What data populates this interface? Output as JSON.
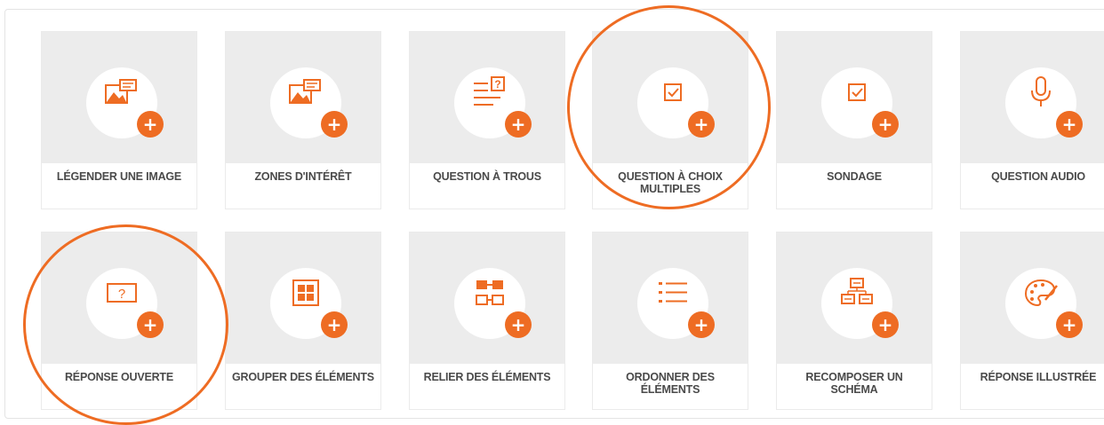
{
  "accent_color": "#ee6c23",
  "tiles": [
    {
      "label": "LÉGENDER UNE IMAGE",
      "icon": "caption-image-icon"
    },
    {
      "label": "ZONES D'INTÉRÊT",
      "icon": "hotspot-image-icon"
    },
    {
      "label": "QUESTION À TROUS",
      "icon": "fill-blanks-icon"
    },
    {
      "label": "QUESTION À CHOIX MULTIPLES",
      "icon": "checkbox-icon"
    },
    {
      "label": "SONDAGE",
      "icon": "checkbox-icon"
    },
    {
      "label": "QUESTION AUDIO",
      "icon": "microphone-icon"
    },
    {
      "label": "RÉPONSE OUVERTE",
      "icon": "open-question-icon"
    },
    {
      "label": "GROUPER DES ÉLÉMENTS",
      "icon": "grid-icon"
    },
    {
      "label": "RELIER DES ÉLÉMENTS",
      "icon": "link-blocks-icon"
    },
    {
      "label": "ORDONNER DES ÉLÉMENTS",
      "icon": "list-icon"
    },
    {
      "label": "RECOMPOSER UN SCHÉMA",
      "icon": "diagram-icon"
    },
    {
      "label": "RÉPONSE ILLUSTRÉE",
      "icon": "palette-icon"
    }
  ],
  "plus_symbol": "+"
}
